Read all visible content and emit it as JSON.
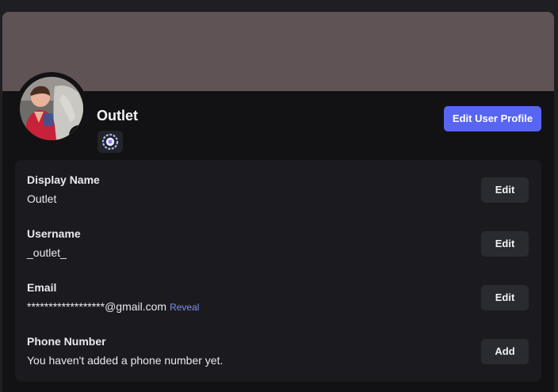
{
  "profile": {
    "name": "Outlet",
    "edit_profile_label": "Edit User Profile",
    "status": "online",
    "status_color": "#3ba55c",
    "banner_color": "#5f5356",
    "accent_color": "#5865f2"
  },
  "fields": [
    {
      "label": "Display Name",
      "value": "Outlet",
      "button": "Edit"
    },
    {
      "label": "Username",
      "value": "_outlet_",
      "button": "Edit"
    },
    {
      "label": "Email",
      "value": "******************@gmail.com",
      "link": "Reveal",
      "button": "Edit"
    },
    {
      "label": "Phone Number",
      "value": "You haven't added a phone number yet.",
      "button": "Add"
    }
  ]
}
